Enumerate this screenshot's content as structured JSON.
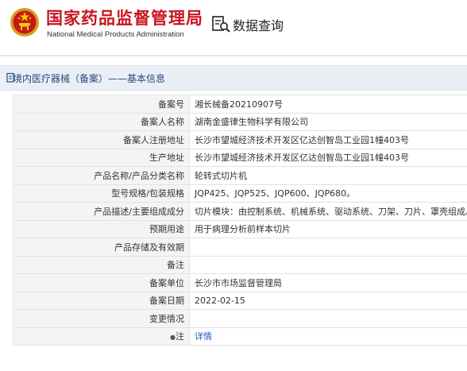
{
  "header": {
    "site_name_cn": "国家药品监督管理局",
    "site_name_en": "National Medical Products Administration",
    "page_title": "数据查询"
  },
  "section": {
    "title": "境内医疗器械（备案）——基本信息"
  },
  "rows": [
    {
      "key": "备案号",
      "value": "湘长械备20210907号"
    },
    {
      "key": "备案人名称",
      "value": "湖南金盛律生物科学有限公司"
    },
    {
      "key": "备案人注册地址",
      "value": "长沙市望城经济技术开发区亿达创智岛工业园1幢403号"
    },
    {
      "key": "生产地址",
      "value": "长沙市望城经济技术开发区亿达创智岛工业园1幢403号"
    },
    {
      "key": "产品名称/产品分类名称",
      "value": "轮转式切片机"
    },
    {
      "key": "型号规格/包装规格",
      "value": "JQP425、JQP525、JQP600、JQP680。"
    },
    {
      "key": "产品描述/主要组成成分",
      "value": "切片模块：由控制系统、机械系统、驱动系统、刀架、刀片、罩壳组成。"
    },
    {
      "key": "预期用途",
      "value": "用于病理分析前样本切片"
    },
    {
      "key": "产品存储及有效期",
      "value": ""
    },
    {
      "key": "备注",
      "value": ""
    },
    {
      "key": "备案单位",
      "value": "长沙市市场监督管理局"
    },
    {
      "key": "备案日期",
      "value": "2022-02-15"
    },
    {
      "key": "变更情况",
      "value": ""
    }
  ],
  "note_row": {
    "key": "注",
    "link": "详情"
  }
}
